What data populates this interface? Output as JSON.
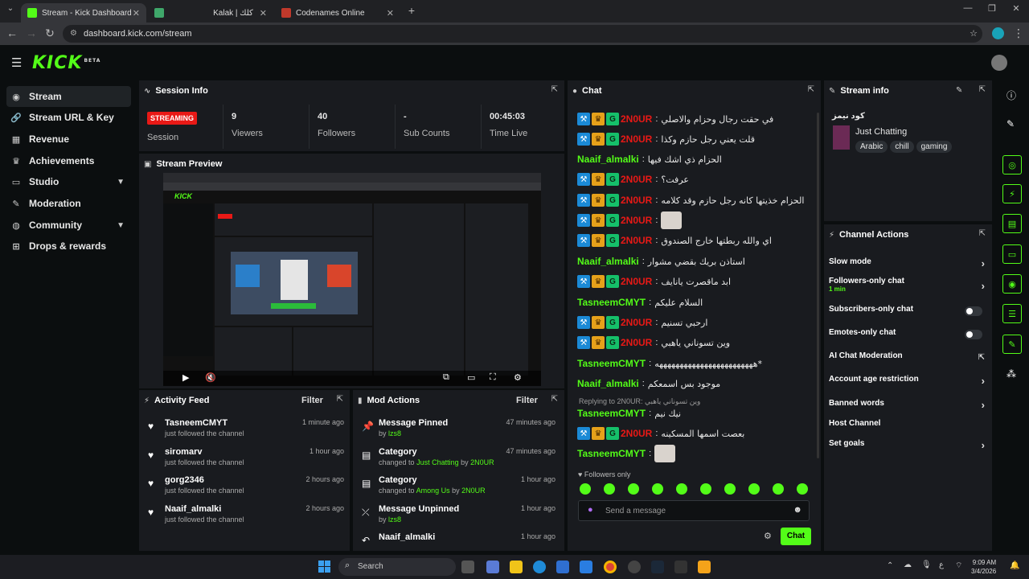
{
  "browser": {
    "tabs": [
      {
        "title": "Stream - Kick Dashboard",
        "active": true
      },
      {
        "title": "Kalak | كلك",
        "active": false
      },
      {
        "title": "Codenames Online",
        "active": false
      }
    ],
    "url": "dashboard.kick.com/stream"
  },
  "brand": {
    "logo": "KICK",
    "beta": "BETA",
    "accent": "#53fc18"
  },
  "sidebar": {
    "items": [
      {
        "label": "Stream",
        "icon": "broadcast-icon",
        "active": true
      },
      {
        "label": "Stream URL & Key",
        "icon": "link-icon"
      },
      {
        "label": "Revenue",
        "icon": "chart-icon"
      },
      {
        "label": "Achievements",
        "icon": "trophy-icon"
      },
      {
        "label": "Studio",
        "icon": "monitor-icon",
        "expandable": true
      },
      {
        "label": "Moderation",
        "icon": "wrench-icon"
      },
      {
        "label": "Community",
        "icon": "globe-icon",
        "expandable": true
      },
      {
        "label": "Drops & rewards",
        "icon": "gift-icon"
      }
    ]
  },
  "session": {
    "title": "Session Info",
    "status": "STREAMING",
    "status_label": "Session",
    "stats": [
      {
        "value": "9",
        "label": "Viewers"
      },
      {
        "value": "40",
        "label": "Followers"
      },
      {
        "value": "-",
        "label": "Sub Counts"
      },
      {
        "value": "00:45:03",
        "label": "Time Live"
      }
    ]
  },
  "preview": {
    "title": "Stream Preview"
  },
  "activity": {
    "title": "Activity Feed",
    "filter": "Filter",
    "items": [
      {
        "name": "TasneemCMYT",
        "action": "just followed the channel",
        "time": "1 minute ago"
      },
      {
        "name": "siromarv",
        "action": "just followed the channel",
        "time": "1 hour ago"
      },
      {
        "name": "gorg2346",
        "action": "just followed the channel",
        "time": "2 hours ago"
      },
      {
        "name": "Naaif_almalki",
        "action": "just followed the channel",
        "time": "2 hours ago"
      }
    ]
  },
  "modactions": {
    "title": "Mod Actions",
    "filter": "Filter",
    "items": [
      {
        "title": "Message Pinned",
        "pre": "by",
        "link": "lzs8",
        "mid": "",
        "link2": "",
        "time": "47 minutes ago"
      },
      {
        "title": "Category",
        "pre": "changed to",
        "link": "Just Chatting",
        "mid": "by",
        "link2": "2N0UR",
        "time": "47 minutes ago"
      },
      {
        "title": "Category",
        "pre": "changed to",
        "link": "Among Us",
        "mid": "by",
        "link2": "2N0UR",
        "time": "1 hour ago"
      },
      {
        "title": "Message Unpinned",
        "pre": "by",
        "link": "lzs8",
        "mid": "",
        "link2": "",
        "time": "1 hour ago"
      },
      {
        "title": "Naaif_almalki",
        "pre": "",
        "link": "",
        "mid": "",
        "link2": "",
        "time": "1 hour ago"
      }
    ]
  },
  "chat": {
    "title": "Chat",
    "messages": [
      {
        "user": "2N0UR",
        "badges": true,
        "color": "#e91916",
        "text": "في حقت رجال وحزام والاصلي"
      },
      {
        "user": "2N0UR",
        "badges": true,
        "color": "#e91916",
        "text": "قلت يعني رجل حازم وكذا"
      },
      {
        "user": "Naaif_almalki",
        "badges": false,
        "color": "#53fc18",
        "text": "الحزام ذي اشك فيها"
      },
      {
        "user": "2N0UR",
        "badges": true,
        "color": "#e91916",
        "text": "عرفت؟"
      },
      {
        "user": "2N0UR",
        "badges": true,
        "color": "#e91916",
        "text": "الحزام خذيتها كانه رجل حازم وقد كلامه"
      },
      {
        "user": "2N0UR",
        "badges": true,
        "color": "#e91916",
        "text": ""
      },
      {
        "user": "2N0UR",
        "badges": true,
        "color": "#e91916",
        "text": "اي والله ربطتها خارج الصندوق"
      },
      {
        "user": "Naaif_almalki",
        "badges": false,
        "color": "#53fc18",
        "text": "استاذن بريك بقضي مشوار"
      },
      {
        "user": "2N0UR",
        "badges": true,
        "color": "#e91916",
        "text": "ابد ماقصرت يانايف"
      },
      {
        "user": "TasneemCMYT",
        "badges": false,
        "color": "#53fc18",
        "text": "السلام عليكم"
      },
      {
        "user": "2N0UR",
        "badges": true,
        "color": "#e91916",
        "text": "ارحبي تسنيم"
      },
      {
        "user": "2N0UR",
        "badges": true,
        "color": "#e91916",
        "text": "وين تسوناني ياهبي"
      },
      {
        "user": "TasneemCMYT",
        "badges": false,
        "color": "#53fc18",
        "text": "ههههههههههههههههههههههههه*"
      },
      {
        "user": "Naaif_almalki",
        "badges": false,
        "color": "#53fc18",
        "text": "موجود بس اسمعكم"
      },
      {
        "user": "TasneemCMYT",
        "badges": false,
        "color": "#53fc18",
        "text": "نيك نيم"
      },
      {
        "user": "2N0UR",
        "badges": true,
        "color": "#e91916",
        "text": "بعصت اسمها المسكينه"
      },
      {
        "user": "TasneemCMYT",
        "badges": false,
        "color": "#53fc18",
        "text": ""
      }
    ],
    "reply_note": "Replying to 2N0UR: وين تسوناني ياهبي",
    "followers_only": "Followers only",
    "placeholder": "Send a message",
    "send_label": "Chat"
  },
  "streaminfo": {
    "title": "Stream info",
    "stream_title": "كود نيمز",
    "category": "Just Chatting",
    "tags": [
      "Arabic",
      "chill",
      "gaming"
    ]
  },
  "channel_actions": {
    "title": "Channel Actions",
    "items": [
      {
        "label": "Slow mode",
        "control": "arrow"
      },
      {
        "label": "Followers-only chat",
        "sub": "1 min",
        "control": "arrow"
      },
      {
        "label": "Subscribers-only chat",
        "control": "toggle"
      },
      {
        "label": "Emotes-only chat",
        "control": "toggle"
      },
      {
        "label": "AI Chat Moderation",
        "control": "external"
      },
      {
        "label": "Account age restriction",
        "control": "arrow"
      },
      {
        "label": "Banned words",
        "control": "arrow"
      },
      {
        "label": "Host Channel",
        "control": "none"
      },
      {
        "label": "Set goals",
        "control": "arrow"
      }
    ]
  },
  "taskbar": {
    "search": "Search",
    "time": "9:09 AM",
    "date": "3/4/2026"
  }
}
